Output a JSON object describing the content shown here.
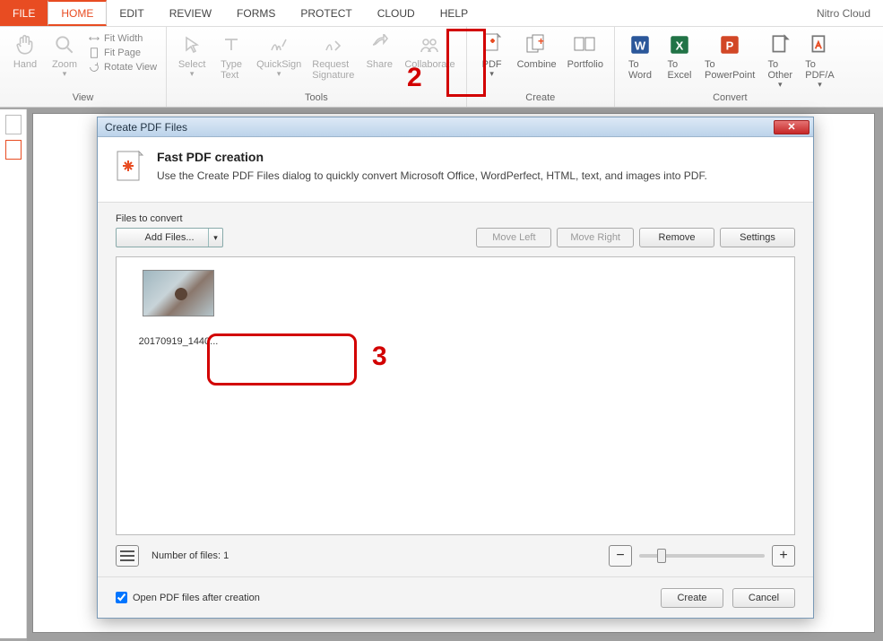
{
  "app": {
    "cloud_label": "Nitro Cloud"
  },
  "tabs": {
    "file": "FILE",
    "home": "HOME",
    "edit": "EDIT",
    "review": "REVIEW",
    "forms": "FORMS",
    "protect": "PROTECT",
    "cloud": "CLOUD",
    "help": "HELP"
  },
  "ribbon": {
    "view": {
      "title": "View",
      "hand": "Hand",
      "zoom": "Zoom",
      "fit_width": "Fit Width",
      "fit_page": "Fit Page",
      "rotate_view": "Rotate View"
    },
    "tools": {
      "title": "Tools",
      "select": "Select",
      "type_text": "Type\nText",
      "quicksign": "QuickSign",
      "request_signature": "Request\nSignature",
      "share": "Share",
      "collaborate": "Collaborate"
    },
    "create": {
      "title": "Create",
      "pdf": "PDF",
      "combine": "Combine",
      "portfolio": "Portfolio"
    },
    "convert": {
      "title": "Convert",
      "to_word": "To\nWord",
      "to_excel": "To\nExcel",
      "to_powerpoint": "To\nPowerPoint",
      "to_other": "To\nOther",
      "to_pdfa": "To\nPDF/A"
    }
  },
  "annotations": {
    "two": "2",
    "three": "3"
  },
  "dialog": {
    "title": "Create PDF Files",
    "heading": "Fast PDF creation",
    "subtext": "Use the Create PDF Files dialog to quickly convert Microsoft Office, WordPerfect, HTML, text, and images into PDF.",
    "files_to_convert": "Files to convert",
    "add_files": "Add Files...",
    "move_left": "Move Left",
    "move_right": "Move Right",
    "remove": "Remove",
    "settings": "Settings",
    "file_item_name": "20170919_1440...",
    "num_files_label": "Number of files: 1",
    "open_after": "Open PDF files after creation",
    "create": "Create",
    "cancel": "Cancel"
  }
}
